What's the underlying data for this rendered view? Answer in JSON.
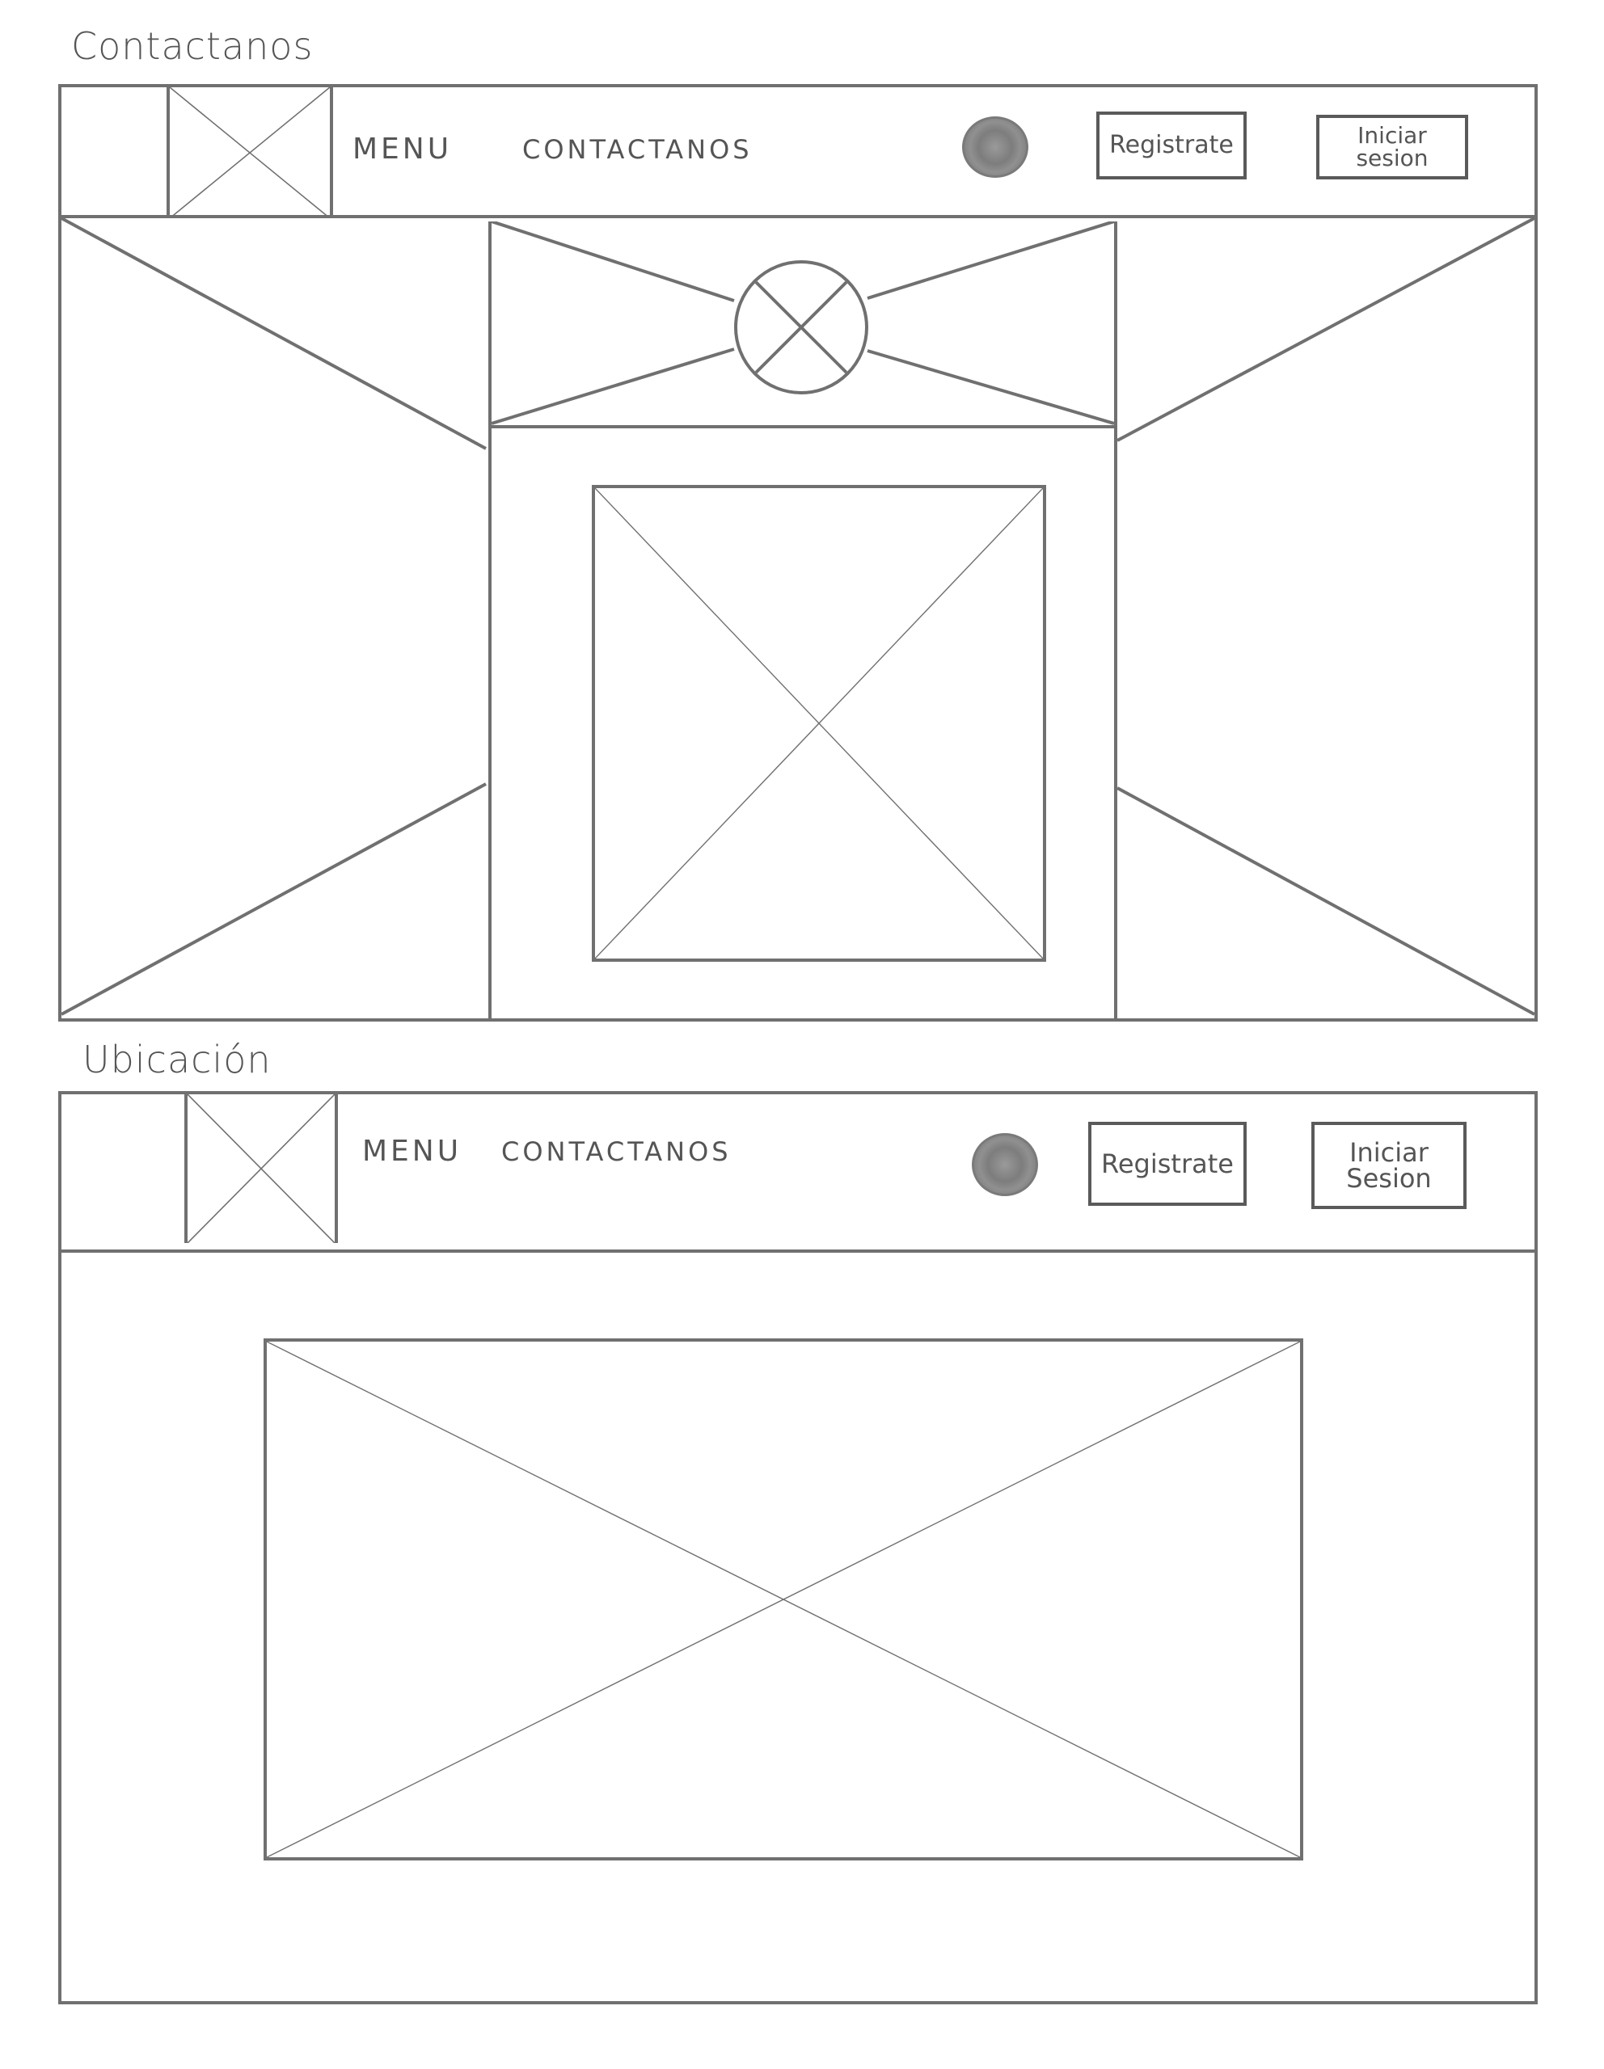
{
  "wireframes": [
    {
      "page_label": "Contactanos",
      "nav": {
        "menu_label": "MENU",
        "contact_label": "CONTACTANOS",
        "avatar_icon": "avatar-icon",
        "register_label": "Registrate",
        "login_label": "Iniciar sesion"
      },
      "content": "hero-with-center-card"
    },
    {
      "page_label": "Ubicación",
      "nav": {
        "menu_label": "MENU",
        "contact_label": "CONTACTANOS",
        "avatar_icon": "avatar-icon",
        "register_label": "Registrate",
        "login_label": "Iniciar Sesion"
      },
      "content": "map-image-placeholder"
    }
  ],
  "colors": {
    "line": "#707070",
    "text": "#555555",
    "background": "#ffffff"
  }
}
